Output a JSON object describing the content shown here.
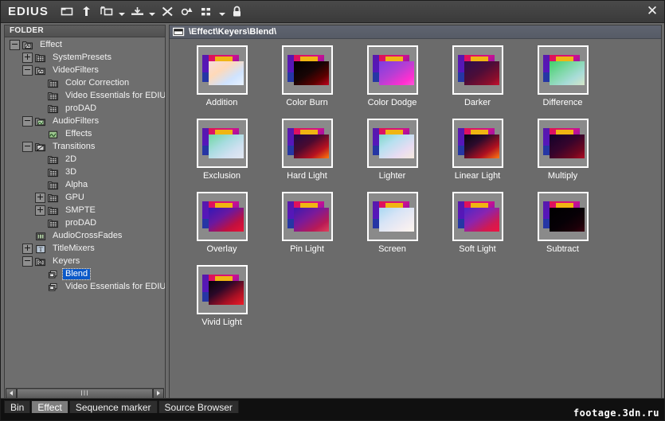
{
  "window": {
    "app_title": "EDIUS",
    "close_label": "✕"
  },
  "toolbar": {
    "items": [
      {
        "name": "open-folder-icon",
        "label": "Open Folder",
        "caret": false
      },
      {
        "name": "up-level-icon",
        "label": "Up One Level",
        "caret": false
      },
      {
        "name": "new-folder-icon",
        "label": "New Folder",
        "caret": true
      },
      {
        "name": "add-clip-icon",
        "label": "Add Clip",
        "caret": true
      },
      {
        "name": "delete-icon",
        "label": "Delete",
        "caret": false
      },
      {
        "name": "properties-icon",
        "label": "Properties",
        "caret": false
      },
      {
        "name": "view-mode-icon",
        "label": "View",
        "caret": true
      },
      {
        "name": "lock-icon",
        "label": "Lock",
        "caret": false
      }
    ]
  },
  "folder_panel": {
    "header": "FOLDER",
    "tree": [
      {
        "label": "Effect",
        "depth": 0,
        "expander": "minus",
        "icon": "folder-effect",
        "selected": false
      },
      {
        "label": "SystemPresets",
        "depth": 1,
        "expander": "plus",
        "icon": "folder-grid",
        "selected": false
      },
      {
        "label": "VideoFilters",
        "depth": 1,
        "expander": "minus",
        "icon": "folder-effect",
        "selected": false
      },
      {
        "label": "Color Correction",
        "depth": 2,
        "expander": "none",
        "icon": "folder-grid",
        "selected": false
      },
      {
        "label": "Video Essentials for EDIU",
        "depth": 2,
        "expander": "none",
        "icon": "folder-grid",
        "selected": false
      },
      {
        "label": "proDAD",
        "depth": 2,
        "expander": "none",
        "icon": "folder-grid",
        "selected": false
      },
      {
        "label": "AudioFilters",
        "depth": 1,
        "expander": "minus",
        "icon": "folder-audio",
        "selected": false
      },
      {
        "label": "Effects",
        "depth": 2,
        "expander": "none",
        "icon": "folder-audio-sm",
        "selected": false
      },
      {
        "label": "Transitions",
        "depth": 1,
        "expander": "minus",
        "icon": "folder-trans",
        "selected": false
      },
      {
        "label": "2D",
        "depth": 2,
        "expander": "none",
        "icon": "folder-grid",
        "selected": false
      },
      {
        "label": "3D",
        "depth": 2,
        "expander": "none",
        "icon": "folder-grid",
        "selected": false
      },
      {
        "label": "Alpha",
        "depth": 2,
        "expander": "none",
        "icon": "folder-grid",
        "selected": false
      },
      {
        "label": "GPU",
        "depth": 2,
        "expander": "plus",
        "icon": "folder-grid",
        "selected": false
      },
      {
        "label": "SMPTE",
        "depth": 2,
        "expander": "plus",
        "icon": "folder-grid",
        "selected": false
      },
      {
        "label": "proDAD",
        "depth": 2,
        "expander": "none",
        "icon": "folder-grid",
        "selected": false
      },
      {
        "label": "AudioCrossFades",
        "depth": 1,
        "expander": "none",
        "icon": "folder-xfade",
        "selected": false
      },
      {
        "label": "TitleMixers",
        "depth": 1,
        "expander": "plus",
        "icon": "folder-title",
        "selected": false
      },
      {
        "label": "Keyers",
        "depth": 1,
        "expander": "minus",
        "icon": "folder-keyer",
        "selected": false
      },
      {
        "label": "Blend",
        "depth": 2,
        "expander": "none",
        "icon": "folder-blend",
        "selected": true
      },
      {
        "label": "Video Essentials for EDIU",
        "depth": 2,
        "expander": "none",
        "icon": "folder-blend",
        "selected": false
      }
    ],
    "scrollbar": {
      "left_label": "◄",
      "right_label": "►",
      "grip": "III"
    }
  },
  "content_panel": {
    "path": "\\Effect\\Keyers\\Blend\\",
    "items": [
      {
        "label": "Addition",
        "front": "addition"
      },
      {
        "label": "Color Burn",
        "front": "colorburn"
      },
      {
        "label": "Color Dodge",
        "front": "colordodge"
      },
      {
        "label": "Darker",
        "front": "darker"
      },
      {
        "label": "Difference",
        "front": "difference"
      },
      {
        "label": "Exclusion",
        "front": "exclusion"
      },
      {
        "label": "Hard Light",
        "front": "hardlight"
      },
      {
        "label": "Lighter",
        "front": "lighter"
      },
      {
        "label": "Linear Light",
        "front": "linearlight"
      },
      {
        "label": "Multiply",
        "front": "multiply"
      },
      {
        "label": "Overlay",
        "front": "overlay"
      },
      {
        "label": "Pin Light",
        "front": "pinlight"
      },
      {
        "label": "Screen",
        "front": "screen"
      },
      {
        "label": "Soft Light",
        "front": "softlight"
      },
      {
        "label": "Subtract",
        "front": "subtract"
      },
      {
        "label": "Vivid Light",
        "front": "vividlight"
      }
    ]
  },
  "tabs": [
    {
      "label": "Bin",
      "active": false
    },
    {
      "label": "Effect",
      "active": true
    },
    {
      "label": "Sequence marker",
      "active": false
    },
    {
      "label": "Source Browser",
      "active": false
    }
  ],
  "watermark": "footage.3dn.ru",
  "colors": {
    "selection": "#0a58c8",
    "panel_bg": "#6b6b6b",
    "titlebar": "#3f3f3f",
    "pathbar": "#5a5f6b",
    "statusbar": "#101010"
  }
}
